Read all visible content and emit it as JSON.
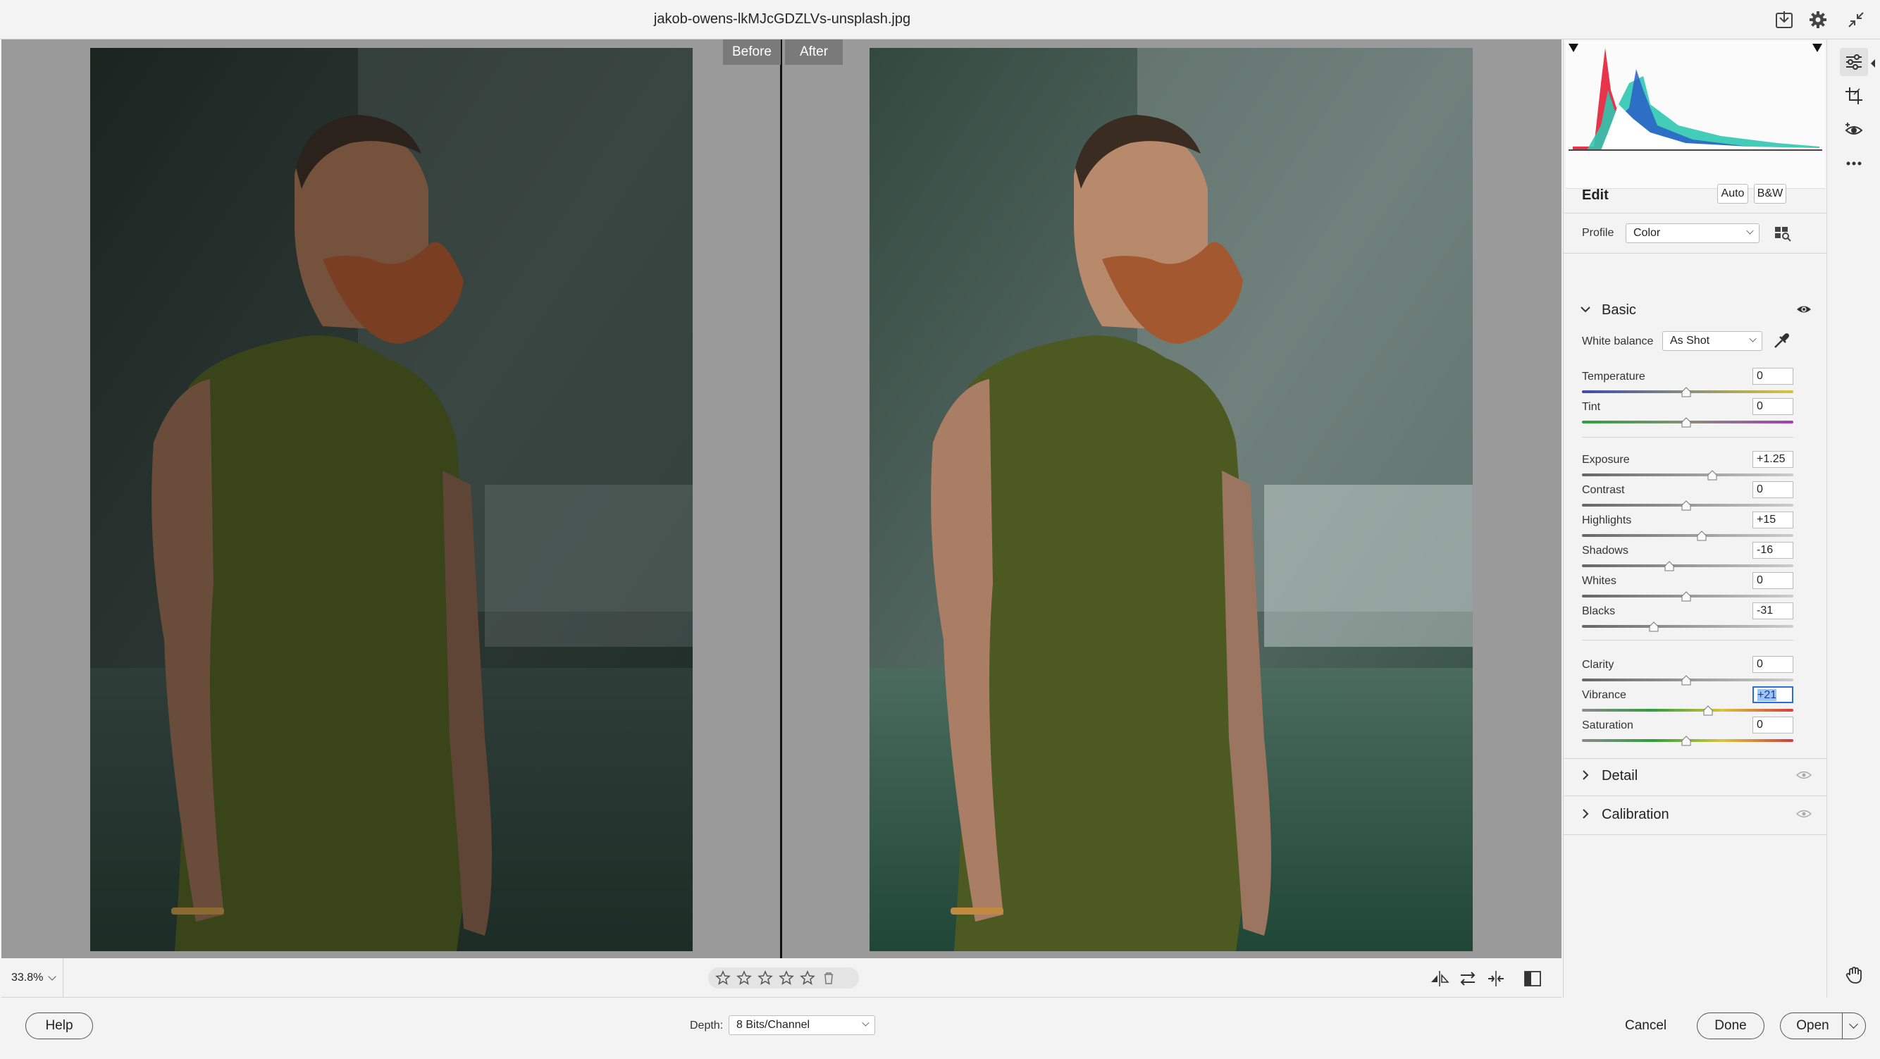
{
  "window": {
    "title": "jakob-owens-lkMJcGDZLVs-unsplash.jpg"
  },
  "titlebar_icons": [
    "save-icon",
    "gear-icon",
    "collapse-icon"
  ],
  "view": {
    "before_label": "Before",
    "after_label": "After"
  },
  "tools": [
    "edit-sliders-icon",
    "crop-icon",
    "red-eye-icon",
    "more-icon",
    "hand-icon"
  ],
  "panel": {
    "edit_title": "Edit",
    "auto_label": "Auto",
    "bw_label": "B&W",
    "profile_label": "Profile",
    "profile_value": "Color",
    "basic": {
      "title": "Basic",
      "white_balance_label": "White balance",
      "white_balance_value": "As Shot",
      "temperature": {
        "label": "Temperature",
        "value": "0"
      },
      "tint": {
        "label": "Tint",
        "value": "0"
      },
      "exposure": {
        "label": "Exposure",
        "value": "+1.25"
      },
      "contrast": {
        "label": "Contrast",
        "value": "0"
      },
      "highlights": {
        "label": "Highlights",
        "value": "+15"
      },
      "shadows": {
        "label": "Shadows",
        "value": "-16"
      },
      "whites": {
        "label": "Whites",
        "value": "0"
      },
      "blacks": {
        "label": "Blacks",
        "value": "-31"
      },
      "clarity": {
        "label": "Clarity",
        "value": "0"
      },
      "vibrance": {
        "label": "Vibrance",
        "value": "+21"
      },
      "saturation": {
        "label": "Saturation",
        "value": "0"
      }
    },
    "detail_title": "Detail",
    "calibration_title": "Calibration"
  },
  "bottom_toolbar": {
    "zoom": "33.8%",
    "rating_stars": 0,
    "icons": [
      "cycle-views-icon",
      "swap-icon",
      "copy-settings-icon",
      "before-after-toggle-icon"
    ]
  },
  "footer": {
    "help_label": "Help",
    "depth_label": "Depth:",
    "depth_value": "8 Bits/Channel",
    "cancel_label": "Cancel",
    "done_label": "Done",
    "open_label": "Open"
  },
  "colors": {
    "focus_blue": "#2a6cd8",
    "canvas_gray": "#9a9a9a",
    "shirt_green": "#4c5a22",
    "beard_red": "#a4582f"
  }
}
